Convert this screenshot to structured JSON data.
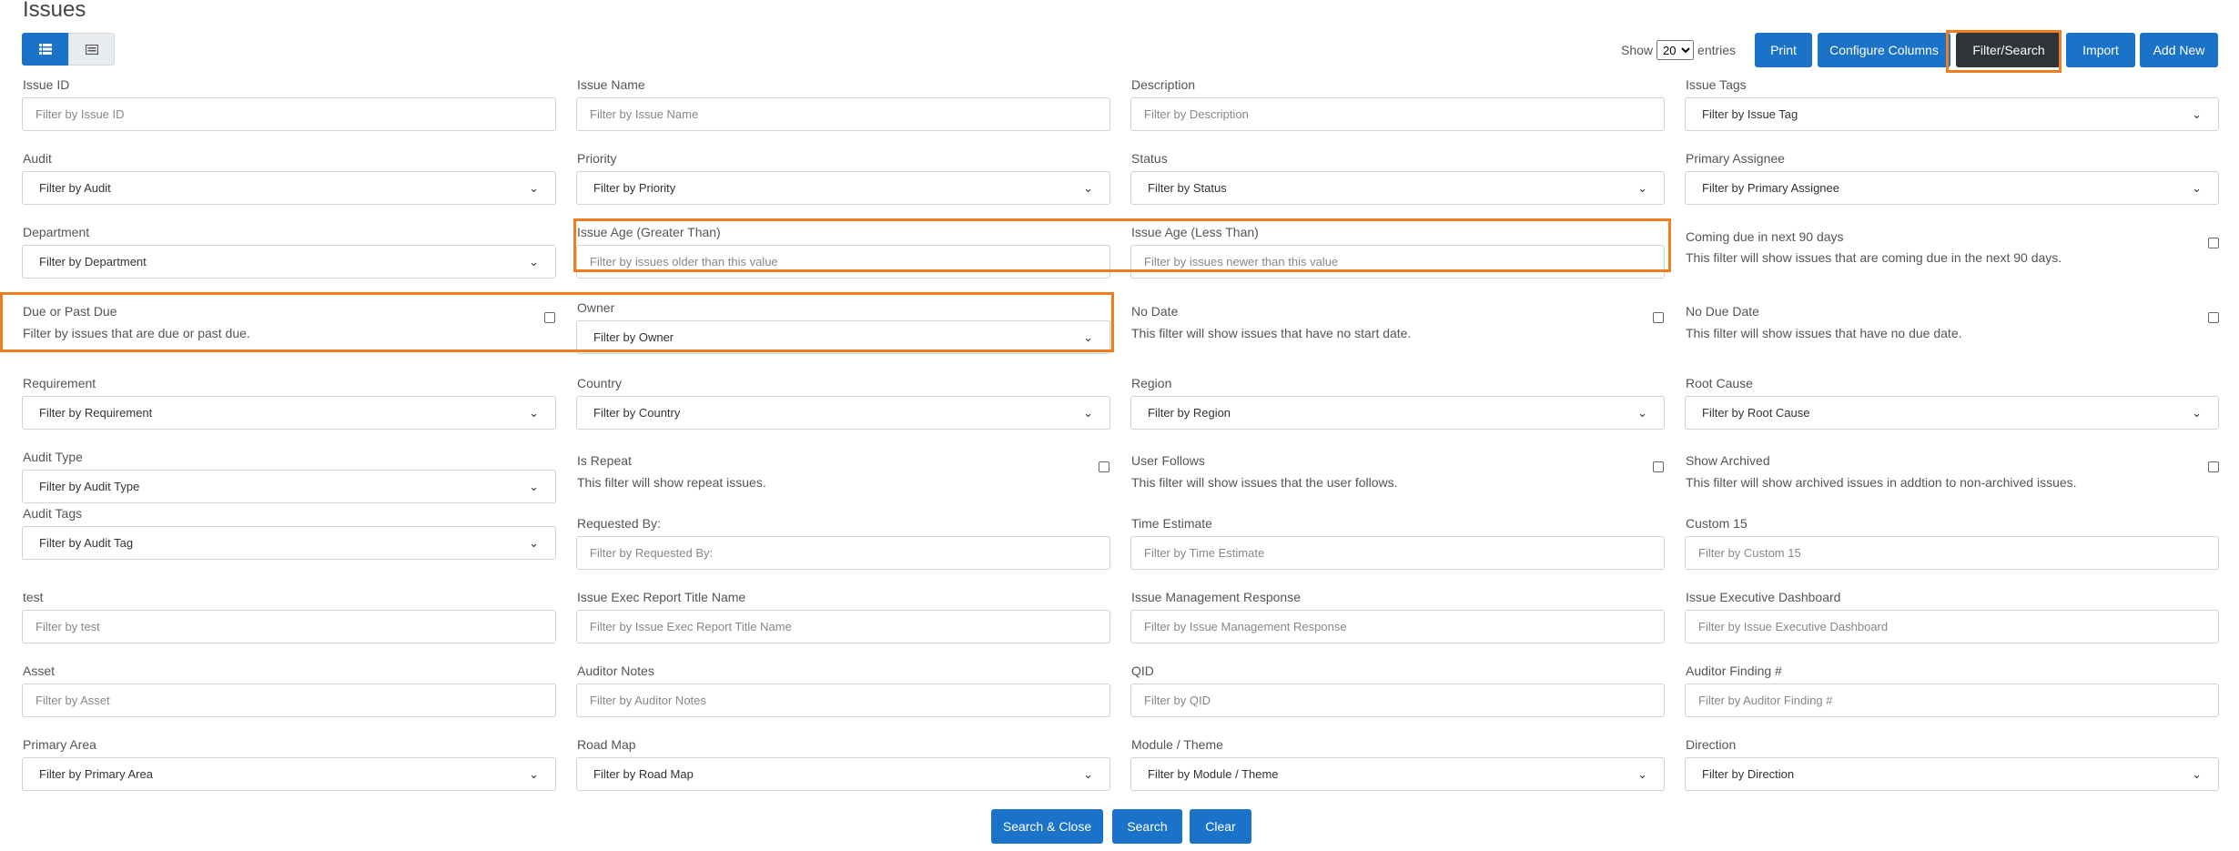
{
  "page": {
    "title": "Issues"
  },
  "toolbar": {
    "show_label": "Show",
    "entries_value": "20",
    "entries_label": "entries",
    "buttons": {
      "print": "Print",
      "configure_columns": "Configure Columns",
      "filter_search": "Filter/Search",
      "import": "Import",
      "add_new": "Add New"
    }
  },
  "filters": {
    "issue_id": {
      "label": "Issue ID",
      "placeholder": "Filter by Issue ID"
    },
    "issue_name": {
      "label": "Issue Name",
      "placeholder": "Filter by Issue Name"
    },
    "description": {
      "label": "Description",
      "placeholder": "Filter by Description"
    },
    "issue_tags": {
      "label": "Issue Tags",
      "value": "Filter by Issue Tag"
    },
    "audit": {
      "label": "Audit",
      "value": "Filter by Audit"
    },
    "priority": {
      "label": "Priority",
      "value": "Filter by Priority"
    },
    "status": {
      "label": "Status",
      "value": "Filter by Status"
    },
    "primary_assignee": {
      "label": "Primary Assignee",
      "value": "Filter by Primary Assignee"
    },
    "department": {
      "label": "Department",
      "value": "Filter by Department"
    },
    "issue_age_gt": {
      "label": "Issue Age (Greater Than)",
      "placeholder": "Filter by issues older than this value"
    },
    "issue_age_lt": {
      "label": "Issue Age (Less Than)",
      "placeholder": "Filter by issues newer than this value"
    },
    "coming_due": {
      "label": "Coming due in next 90 days",
      "desc": "This filter will show issues that are coming due in the next 90 days."
    },
    "due_or_past_due": {
      "label": "Due or Past Due",
      "desc": "Filter by issues that are due or past due."
    },
    "owner": {
      "label": "Owner",
      "value": "Filter by Owner"
    },
    "no_date": {
      "label": "No Date",
      "desc": "This filter will show issues that have no start date."
    },
    "no_due_date": {
      "label": "No Due Date",
      "desc": "This filter will show issues that have no due date."
    },
    "requirement": {
      "label": "Requirement",
      "value": "Filter by Requirement"
    },
    "country": {
      "label": "Country",
      "value": "Filter by Country"
    },
    "region": {
      "label": "Region",
      "value": "Filter by Region"
    },
    "root_cause": {
      "label": "Root Cause",
      "value": "Filter by Root Cause"
    },
    "audit_type": {
      "label": "Audit Type",
      "value": "Filter by Audit Type"
    },
    "is_repeat": {
      "label": "Is Repeat",
      "desc": "This filter will show repeat issues."
    },
    "user_follows": {
      "label": "User Follows",
      "desc": "This filter will show issues that the user follows."
    },
    "show_archived": {
      "label": "Show Archived",
      "desc": "This filter will show archived issues in addtion to non-archived issues."
    },
    "audit_tags": {
      "label": "Audit Tags",
      "value": "Filter by Audit Tag"
    },
    "requested_by": {
      "label": "Requested By:",
      "placeholder": "Filter by Requested By:"
    },
    "time_estimate": {
      "label": "Time Estimate",
      "placeholder": "Filter by Time Estimate"
    },
    "custom_15": {
      "label": "Custom 15",
      "placeholder": "Filter by Custom 15"
    },
    "test": {
      "label": "test",
      "placeholder": "Filter by test"
    },
    "exec_report_title": {
      "label": "Issue Exec Report Title Name",
      "placeholder": "Filter by Issue Exec Report Title Name"
    },
    "mgmt_response": {
      "label": "Issue Management Response",
      "placeholder": "Filter by Issue Management Response"
    },
    "exec_dashboard": {
      "label": "Issue Executive Dashboard",
      "placeholder": "Filter by Issue Executive Dashboard"
    },
    "asset": {
      "label": "Asset",
      "placeholder": "Filter by Asset"
    },
    "auditor_notes": {
      "label": "Auditor Notes",
      "placeholder": "Filter by Auditor Notes"
    },
    "qid": {
      "label": "QID",
      "placeholder": "Filter by QID"
    },
    "auditor_finding": {
      "label": "Auditor Finding #",
      "placeholder": "Filter by Auditor Finding #"
    },
    "primary_area": {
      "label": "Primary Area",
      "value": "Filter by Primary Area"
    },
    "road_map": {
      "label": "Road Map",
      "value": "Filter by Road Map"
    },
    "module_theme": {
      "label": "Module / Theme",
      "value": "Filter by Module / Theme"
    },
    "direction": {
      "label": "Direction",
      "value": "Filter by Direction"
    }
  },
  "actions": {
    "search_close": "Search & Close",
    "search": "Search",
    "clear": "Clear"
  },
  "colors": {
    "primary": "#1a73c8",
    "dark": "#2f3438",
    "highlight": "#ef7d22"
  }
}
